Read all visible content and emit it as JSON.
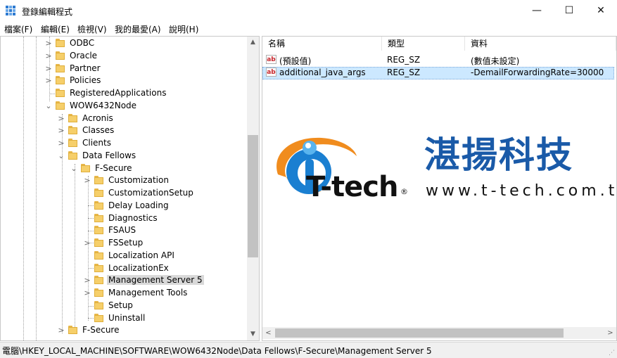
{
  "window": {
    "title": "登錄編輯程式",
    "minimize": "—",
    "maximize": "☐",
    "close": "✕"
  },
  "menu": [
    "檔案(F)",
    "編輯(E)",
    "檢視(V)",
    "我的最愛(A)",
    "說明(H)"
  ],
  "tree": {
    "items": [
      {
        "label": "ODBC",
        "expander": ">"
      },
      {
        "label": "Oracle",
        "expander": ">"
      },
      {
        "label": "Partner",
        "expander": ">"
      },
      {
        "label": "Policies",
        "expander": ">"
      },
      {
        "label": "RegisteredApplications",
        "expander": ""
      },
      {
        "label": "WOW6432Node",
        "expander": "v"
      },
      {
        "label": "Acronis",
        "expander": ">"
      },
      {
        "label": "Classes",
        "expander": ">"
      },
      {
        "label": "Clients",
        "expander": ">"
      },
      {
        "label": "Data Fellows",
        "expander": "v"
      },
      {
        "label": "F-Secure",
        "expander": "v"
      },
      {
        "label": "Customization",
        "expander": ">"
      },
      {
        "label": "CustomizationSetup",
        "expander": ""
      },
      {
        "label": "Delay Loading",
        "expander": ""
      },
      {
        "label": "Diagnostics",
        "expander": ""
      },
      {
        "label": "FSAUS",
        "expander": ""
      },
      {
        "label": "FSSetup",
        "expander": ">"
      },
      {
        "label": "Localization API",
        "expander": ""
      },
      {
        "label": "LocalizationEx",
        "expander": ""
      },
      {
        "label": "Management Server 5",
        "expander": ">"
      },
      {
        "label": "Management Tools",
        "expander": ">"
      },
      {
        "label": "Setup",
        "expander": ""
      },
      {
        "label": "Uninstall",
        "expander": ""
      },
      {
        "label": "F-Secure",
        "expander": ">"
      }
    ],
    "selected": "Management Server 5"
  },
  "list": {
    "columns": [
      "名稱",
      "類型",
      "資料"
    ],
    "rows": [
      {
        "name": "(預設值)",
        "type": "REG_SZ",
        "data": "(數值未設定)",
        "icon": "ab"
      },
      {
        "name": "additional_java_args",
        "type": "REG_SZ",
        "data": "-DemailForwardingRate=30000",
        "icon": "ab"
      }
    ]
  },
  "watermark": {
    "brand_cn": "湛揚科技",
    "brand_en": "T-tech",
    "registered": "®",
    "url": "www.t-tech.com.tw"
  },
  "status": {
    "path": "電腦\\HKEY_LOCAL_MACHINE\\SOFTWARE\\WOW6432Node\\Data Fellows\\F-Secure\\Management Server 5"
  },
  "colors": {
    "selection": "#cce8ff",
    "folder": "#f6cf6a",
    "brand_blue": "#1a5aa8",
    "logo_orange": "#f08c1e"
  },
  "icons": {
    "app": "registry-editor-icon",
    "folder": "folder-icon",
    "value": "string-value-icon"
  }
}
